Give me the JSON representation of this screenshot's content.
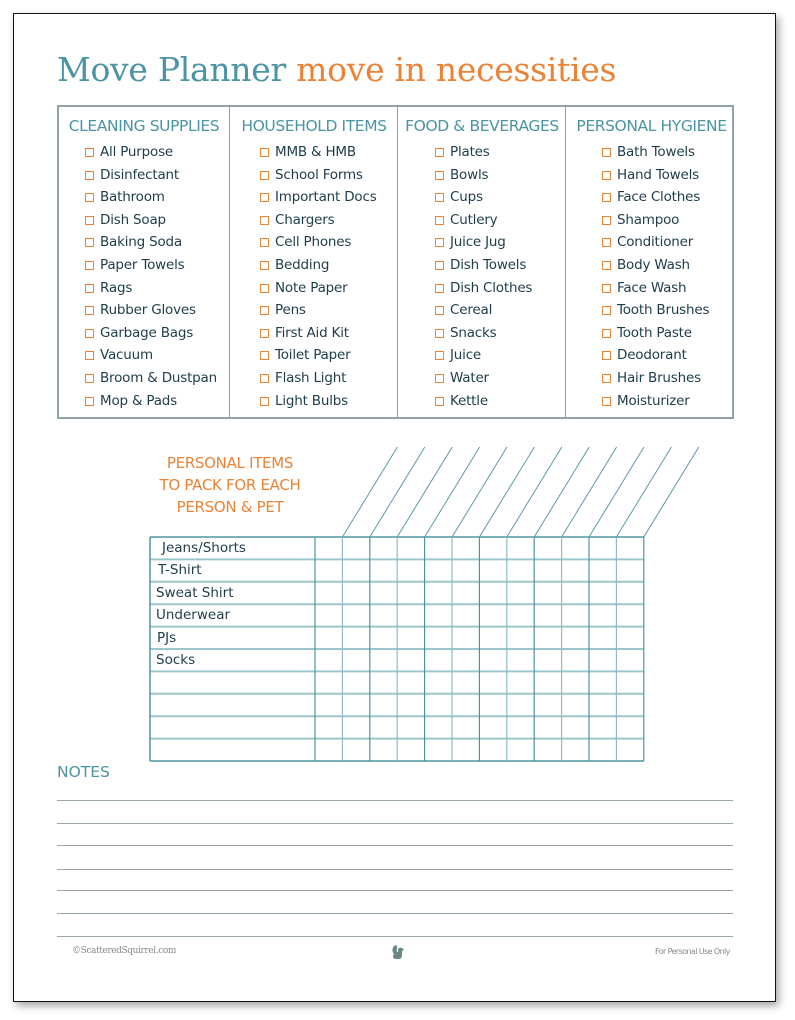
{
  "title": {
    "main": "Move Planner",
    "sub": "move in necessities"
  },
  "colors": {
    "teal": "#4a94a4",
    "orange": "#ec8235",
    "text": "#1e3d4a",
    "border": "#8fa3a5"
  },
  "categories": [
    {
      "heading": "CLEANING SUPPLIES",
      "items": [
        "All Purpose",
        "Disinfectant",
        "Bathroom",
        "Dish Soap",
        "Baking Soda",
        "Paper Towels",
        "Rags",
        "Rubber Gloves",
        "Garbage Bags",
        "Vacuum",
        "Broom & Dustpan",
        "Mop & Pads"
      ]
    },
    {
      "heading": "HOUSEHOLD ITEMS",
      "items": [
        "MMB & HMB",
        "School Forms",
        "Important Docs",
        "Chargers",
        "Cell Phones",
        "Bedding",
        "Note Paper",
        "Pens",
        "First Aid Kit",
        "Toilet Paper",
        "Flash Light",
        "Light Bulbs"
      ]
    },
    {
      "heading": "FOOD & BEVERAGES",
      "items": [
        "Plates",
        "Bowls",
        "Cups",
        "Cutlery",
        "Juice Jug",
        "Dish Towels",
        "Dish Clothes",
        "Cereal",
        "Snacks",
        "Juice",
        "Water",
        "Kettle"
      ]
    },
    {
      "heading": "PERSONAL HYGIENE",
      "items": [
        "Bath Towels",
        "Hand Towels",
        "Face Clothes",
        "Shampoo",
        "Conditioner",
        "Body Wash",
        "Face Wash",
        "Tooth Brushes",
        "Tooth Paste",
        "Deodorant",
        "Hair Brushes",
        "Moisturizer"
      ]
    }
  ],
  "personal_items": {
    "title_lines": [
      "PERSONAL ITEMS",
      "TO PACK FOR EACH",
      "PERSON & PET"
    ],
    "rows": [
      "Jeans/Shorts",
      "T-Shirt",
      "Sweat Shirt",
      "Underwear",
      "PJs",
      "Socks",
      "",
      "",
      "",
      ""
    ],
    "person_columns": 12
  },
  "notes": {
    "title": "NOTES",
    "line_count": 7
  },
  "footer": {
    "left": "©ScatteredSquirrel.com",
    "right": "For Personal Use Only",
    "center_icon": "squirrel-icon"
  }
}
